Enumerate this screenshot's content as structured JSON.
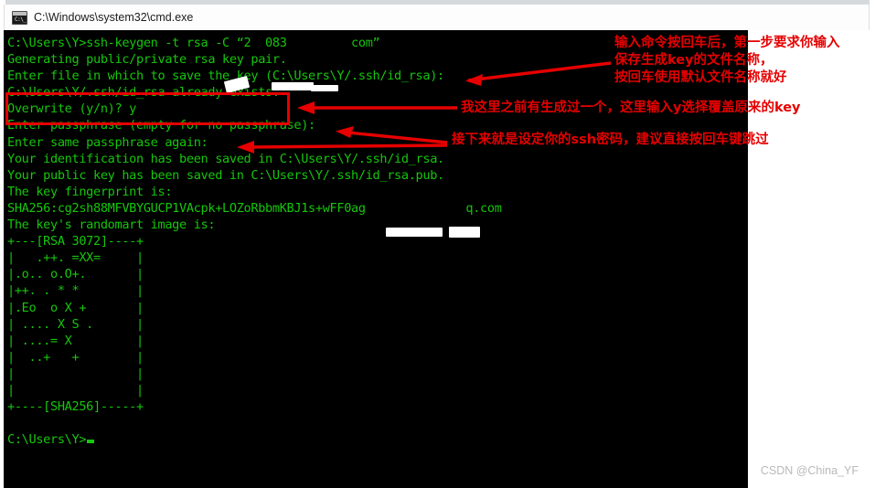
{
  "window": {
    "title": "C:\\Windows\\system32\\cmd.exe",
    "icon": "cmd-icon",
    "icon_prompt": "C:\\_"
  },
  "theme": {
    "console_background": "#000000",
    "console_text": "#16c60c",
    "annotation_red": "#e60000",
    "page_background": "#ffffff",
    "watermark_gray": "#b9b9b9"
  },
  "console": {
    "lines": [
      "C:\\Users\\Y>ssh-keygen -t rsa -C “2  083         com”",
      "Generating public/private rsa key pair.",
      "Enter file in which to save the key (C:\\Users\\Y/.ssh/id_rsa):",
      "C:\\Users\\Y/.ssh/id_rsa already exists.",
      "Overwrite (y/n)? y",
      "Enter passphrase (empty for no passphrase):",
      "Enter same passphrase again:",
      "Your identification has been saved in C:\\Users\\Y/.ssh/id_rsa.",
      "Your public key has been saved in C:\\Users\\Y/.ssh/id_rsa.pub.",
      "The key fingerprint is:",
      "SHA256:cg2sh88MFVBYGUCP1VAcpk+LOZoRbbmKBJ1s+wFF0ag              q.com",
      "The key's randomart image is:",
      "+---[RSA 3072]----+",
      "|   .++. =XX=     |",
      "|.o.. o.O+.       |",
      "|++. . * *        |",
      "|.Eo  o X +       |",
      "| .... X S .      |",
      "| ....= X         |",
      "|  ..+   +        |",
      "|                 |",
      "|                 |",
      "+----[SHA256]-----+",
      "",
      "C:\\Users\\Y>"
    ],
    "prompt_cursor": "block"
  },
  "annotations": {
    "note_1": "输入命令按回车后，第一步要求你输入\n保存生成key的文件名称，\n按回车使用默认文件名称就好",
    "note_2": "我这里之前有生成过一个，这里输入y选择覆盖原来的key",
    "note_3": "接下来就是设定你的ssh密码，建议直接按回车键跳过",
    "highlight_box_target": "Overwrite (y/n)? y"
  },
  "watermark": {
    "text": "CSDN @China_YF"
  }
}
